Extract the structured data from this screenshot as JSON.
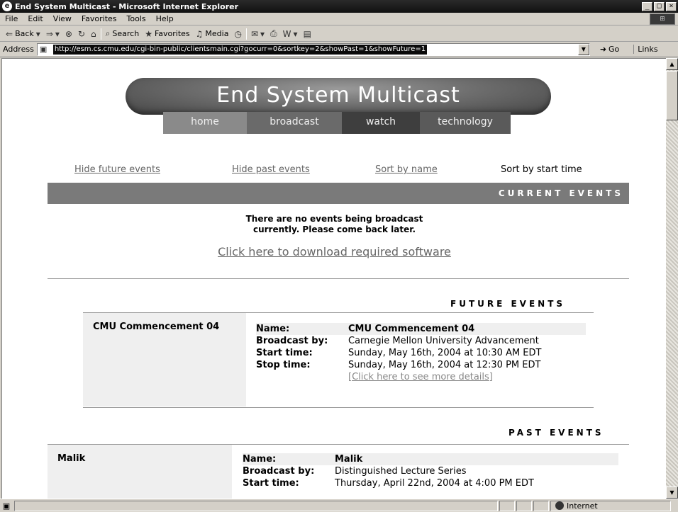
{
  "window": {
    "title": "End System Multicast - Microsoft Internet Explorer",
    "buttons": [
      "_",
      "□",
      "×"
    ]
  },
  "menu": [
    "File",
    "Edit",
    "View",
    "Favorites",
    "Tools",
    "Help"
  ],
  "toolbar": {
    "back": "Back",
    "search": "Search",
    "favorites": "Favorites",
    "media": "Media"
  },
  "address": {
    "label": "Address",
    "url": "http://esm.cs.cmu.edu/cgi-bin-public/clientsmain.cgi?gocurr=0&sortkey=2&showPast=1&showFuture=1",
    "go": "Go",
    "links": "Links"
  },
  "page": {
    "banner": "End System Multicast",
    "nav": [
      "home",
      "broadcast",
      "watch",
      "technology"
    ],
    "sort": {
      "hide_future": "Hide future events",
      "hide_past": "Hide past events",
      "sort_name": "Sort by name",
      "sort_start": "Sort by start time"
    },
    "current": {
      "heading": "CURRENT EVENTS",
      "line1": "There are no events being broadcast",
      "line2": "currently. Please come back later.",
      "download": "Click here to download required software"
    },
    "future": {
      "heading": "FUTURE EVENTS",
      "event": {
        "title": "CMU Commencement 04",
        "name_label": "Name:",
        "name": "CMU Commencement 04",
        "by_label": "Broadcast by:",
        "by": "Carnegie Mellon University Advancement",
        "start_label": "Start time:",
        "start": "Sunday, May 16th, 2004 at 10:30 AM EDT",
        "stop_label": "Stop time:",
        "stop": "Sunday, May 16th, 2004 at 12:30 PM EDT",
        "more": "[Click here to see more details]"
      }
    },
    "past": {
      "heading": "PAST EVENTS",
      "event": {
        "title": "Malik",
        "name_label": "Name:",
        "name": "Malik",
        "by_label": "Broadcast by:",
        "by": "Distinguished Lecture Series",
        "start_label": "Start time:",
        "start": "Thursday, April 22nd, 2004 at 4:00 PM EDT"
      }
    }
  },
  "status": {
    "zone": "Internet"
  }
}
